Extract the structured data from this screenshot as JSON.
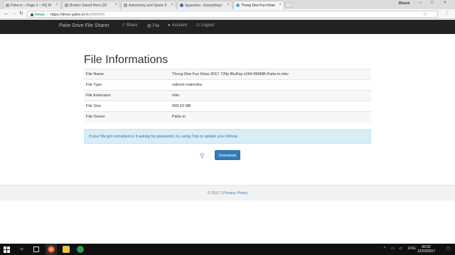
{
  "browser": {
    "tabs": [
      {
        "label": "Pahe.in – Page 2 – HQ M",
        "active": false
      },
      {
        "label": "Broken Sword Hero (20",
        "active": false
      },
      {
        "label": "Astronomy and Space F",
        "active": false
      },
      {
        "label": "Spacetica - Everything t",
        "active": false
      },
      {
        "label": "Thong Dee Fun Khao 20",
        "active": true
      }
    ],
    "user_name": "Bisoni",
    "address": {
      "secure_label": "Aman",
      "url_host": "https://drive.pahe.in",
      "url_path": "/file/59009#"
    }
  },
  "navbar": {
    "brand": "Pahe Drive File Sharer",
    "links": [
      {
        "label": "Share",
        "icon": "share-icon"
      },
      {
        "label": "File",
        "icon": "file-icon"
      },
      {
        "label": "Account",
        "icon": "user-icon"
      },
      {
        "label": "Logout",
        "icon": "logout-icon"
      }
    ]
  },
  "page": {
    "title": "File Informations",
    "rows": [
      {
        "key": "File Name",
        "value": "Thong Dee Fun Khao 2017 720p BluRay x264 999MB-Pahe.in.mkv"
      },
      {
        "key": "File Type",
        "value": "video/x-matroska"
      },
      {
        "key": "File Extension",
        "value": "mkv"
      },
      {
        "key": "File Size",
        "value": "998.53 MB"
      },
      {
        "key": "File Owner",
        "value": "Pahe.in"
      }
    ],
    "alert": "If your file got corrupted or it asking for password, try using 7zip or update your Winrar.",
    "download_label": "Download",
    "footer_copyright": "© 2017 |",
    "footer_link": "Privacy Policy"
  },
  "taskbar": {
    "language": "ENG",
    "time": "00:02",
    "date": "12/23/2017"
  },
  "colors": {
    "navbar_bg": "#222222",
    "button_primary": "#337ab7",
    "alert_bg": "#d9edf7",
    "alert_text": "#31708f"
  }
}
